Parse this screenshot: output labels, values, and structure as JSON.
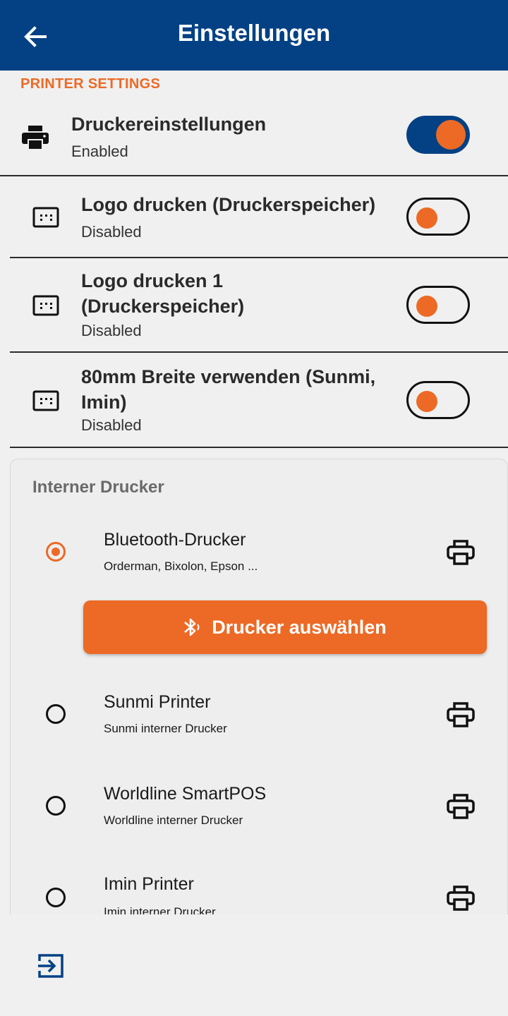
{
  "appbar": {
    "title": "Einstellungen",
    "back_icon": "arrow-left-icon"
  },
  "colors": {
    "primary": "#034184",
    "accent": "#ec6a26"
  },
  "section_header": "PRINTER SETTINGS",
  "settings": [
    {
      "label": "Druckereinstellungen",
      "status": "Enabled",
      "enabled": true
    },
    {
      "label": "Logo drucken (Druckerspeicher)",
      "status": "Disabled",
      "enabled": false
    },
    {
      "label": "Logo drucken 1 (Druckerspeicher)",
      "status": "Disabled",
      "enabled": false
    },
    {
      "label": "80mm Breite verwenden (Sunmi, Imin)",
      "status": "Disabled",
      "enabled": false
    }
  ],
  "printer_card": {
    "title": "Interner Drucker",
    "select_button": "Drucker auswählen",
    "options": [
      {
        "name": "Bluetooth-Drucker",
        "desc": "Orderman, Bixolon, Epson ...",
        "selected": true
      },
      {
        "name": "Sunmi Printer",
        "desc": "Sunmi interner Drucker",
        "selected": false
      },
      {
        "name": "Worldline SmartPOS",
        "desc": "Worldline interner Drucker",
        "selected": false
      },
      {
        "name": "Imin Printer",
        "desc": "Imin interner Drucker",
        "selected": false
      }
    ]
  },
  "footer": {
    "icon": "logout-icon"
  }
}
